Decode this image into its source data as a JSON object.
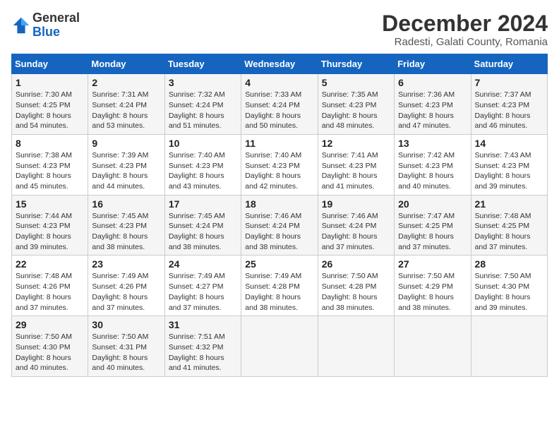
{
  "header": {
    "logo_general": "General",
    "logo_blue": "Blue",
    "month_title": "December 2024",
    "location": "Radesti, Galati County, Romania"
  },
  "days_of_week": [
    "Sunday",
    "Monday",
    "Tuesday",
    "Wednesday",
    "Thursday",
    "Friday",
    "Saturday"
  ],
  "weeks": [
    [
      {
        "day": "1",
        "sunrise": "Sunrise: 7:30 AM",
        "sunset": "Sunset: 4:25 PM",
        "daylight": "Daylight: 8 hours and 54 minutes."
      },
      {
        "day": "2",
        "sunrise": "Sunrise: 7:31 AM",
        "sunset": "Sunset: 4:24 PM",
        "daylight": "Daylight: 8 hours and 53 minutes."
      },
      {
        "day": "3",
        "sunrise": "Sunrise: 7:32 AM",
        "sunset": "Sunset: 4:24 PM",
        "daylight": "Daylight: 8 hours and 51 minutes."
      },
      {
        "day": "4",
        "sunrise": "Sunrise: 7:33 AM",
        "sunset": "Sunset: 4:24 PM",
        "daylight": "Daylight: 8 hours and 50 minutes."
      },
      {
        "day": "5",
        "sunrise": "Sunrise: 7:35 AM",
        "sunset": "Sunset: 4:23 PM",
        "daylight": "Daylight: 8 hours and 48 minutes."
      },
      {
        "day": "6",
        "sunrise": "Sunrise: 7:36 AM",
        "sunset": "Sunset: 4:23 PM",
        "daylight": "Daylight: 8 hours and 47 minutes."
      },
      {
        "day": "7",
        "sunrise": "Sunrise: 7:37 AM",
        "sunset": "Sunset: 4:23 PM",
        "daylight": "Daylight: 8 hours and 46 minutes."
      }
    ],
    [
      {
        "day": "8",
        "sunrise": "Sunrise: 7:38 AM",
        "sunset": "Sunset: 4:23 PM",
        "daylight": "Daylight: 8 hours and 45 minutes."
      },
      {
        "day": "9",
        "sunrise": "Sunrise: 7:39 AM",
        "sunset": "Sunset: 4:23 PM",
        "daylight": "Daylight: 8 hours and 44 minutes."
      },
      {
        "day": "10",
        "sunrise": "Sunrise: 7:40 AM",
        "sunset": "Sunset: 4:23 PM",
        "daylight": "Daylight: 8 hours and 43 minutes."
      },
      {
        "day": "11",
        "sunrise": "Sunrise: 7:40 AM",
        "sunset": "Sunset: 4:23 PM",
        "daylight": "Daylight: 8 hours and 42 minutes."
      },
      {
        "day": "12",
        "sunrise": "Sunrise: 7:41 AM",
        "sunset": "Sunset: 4:23 PM",
        "daylight": "Daylight: 8 hours and 41 minutes."
      },
      {
        "day": "13",
        "sunrise": "Sunrise: 7:42 AM",
        "sunset": "Sunset: 4:23 PM",
        "daylight": "Daylight: 8 hours and 40 minutes."
      },
      {
        "day": "14",
        "sunrise": "Sunrise: 7:43 AM",
        "sunset": "Sunset: 4:23 PM",
        "daylight": "Daylight: 8 hours and 39 minutes."
      }
    ],
    [
      {
        "day": "15",
        "sunrise": "Sunrise: 7:44 AM",
        "sunset": "Sunset: 4:23 PM",
        "daylight": "Daylight: 8 hours and 39 minutes."
      },
      {
        "day": "16",
        "sunrise": "Sunrise: 7:45 AM",
        "sunset": "Sunset: 4:23 PM",
        "daylight": "Daylight: 8 hours and 38 minutes."
      },
      {
        "day": "17",
        "sunrise": "Sunrise: 7:45 AM",
        "sunset": "Sunset: 4:24 PM",
        "daylight": "Daylight: 8 hours and 38 minutes."
      },
      {
        "day": "18",
        "sunrise": "Sunrise: 7:46 AM",
        "sunset": "Sunset: 4:24 PM",
        "daylight": "Daylight: 8 hours and 38 minutes."
      },
      {
        "day": "19",
        "sunrise": "Sunrise: 7:46 AM",
        "sunset": "Sunset: 4:24 PM",
        "daylight": "Daylight: 8 hours and 37 minutes."
      },
      {
        "day": "20",
        "sunrise": "Sunrise: 7:47 AM",
        "sunset": "Sunset: 4:25 PM",
        "daylight": "Daylight: 8 hours and 37 minutes."
      },
      {
        "day": "21",
        "sunrise": "Sunrise: 7:48 AM",
        "sunset": "Sunset: 4:25 PM",
        "daylight": "Daylight: 8 hours and 37 minutes."
      }
    ],
    [
      {
        "day": "22",
        "sunrise": "Sunrise: 7:48 AM",
        "sunset": "Sunset: 4:26 PM",
        "daylight": "Daylight: 8 hours and 37 minutes."
      },
      {
        "day": "23",
        "sunrise": "Sunrise: 7:49 AM",
        "sunset": "Sunset: 4:26 PM",
        "daylight": "Daylight: 8 hours and 37 minutes."
      },
      {
        "day": "24",
        "sunrise": "Sunrise: 7:49 AM",
        "sunset": "Sunset: 4:27 PM",
        "daylight": "Daylight: 8 hours and 37 minutes."
      },
      {
        "day": "25",
        "sunrise": "Sunrise: 7:49 AM",
        "sunset": "Sunset: 4:28 PM",
        "daylight": "Daylight: 8 hours and 38 minutes."
      },
      {
        "day": "26",
        "sunrise": "Sunrise: 7:50 AM",
        "sunset": "Sunset: 4:28 PM",
        "daylight": "Daylight: 8 hours and 38 minutes."
      },
      {
        "day": "27",
        "sunrise": "Sunrise: 7:50 AM",
        "sunset": "Sunset: 4:29 PM",
        "daylight": "Daylight: 8 hours and 38 minutes."
      },
      {
        "day": "28",
        "sunrise": "Sunrise: 7:50 AM",
        "sunset": "Sunset: 4:30 PM",
        "daylight": "Daylight: 8 hours and 39 minutes."
      }
    ],
    [
      {
        "day": "29",
        "sunrise": "Sunrise: 7:50 AM",
        "sunset": "Sunset: 4:30 PM",
        "daylight": "Daylight: 8 hours and 40 minutes."
      },
      {
        "day": "30",
        "sunrise": "Sunrise: 7:50 AM",
        "sunset": "Sunset: 4:31 PM",
        "daylight": "Daylight: 8 hours and 40 minutes."
      },
      {
        "day": "31",
        "sunrise": "Sunrise: 7:51 AM",
        "sunset": "Sunset: 4:32 PM",
        "daylight": "Daylight: 8 hours and 41 minutes."
      },
      null,
      null,
      null,
      null
    ]
  ]
}
